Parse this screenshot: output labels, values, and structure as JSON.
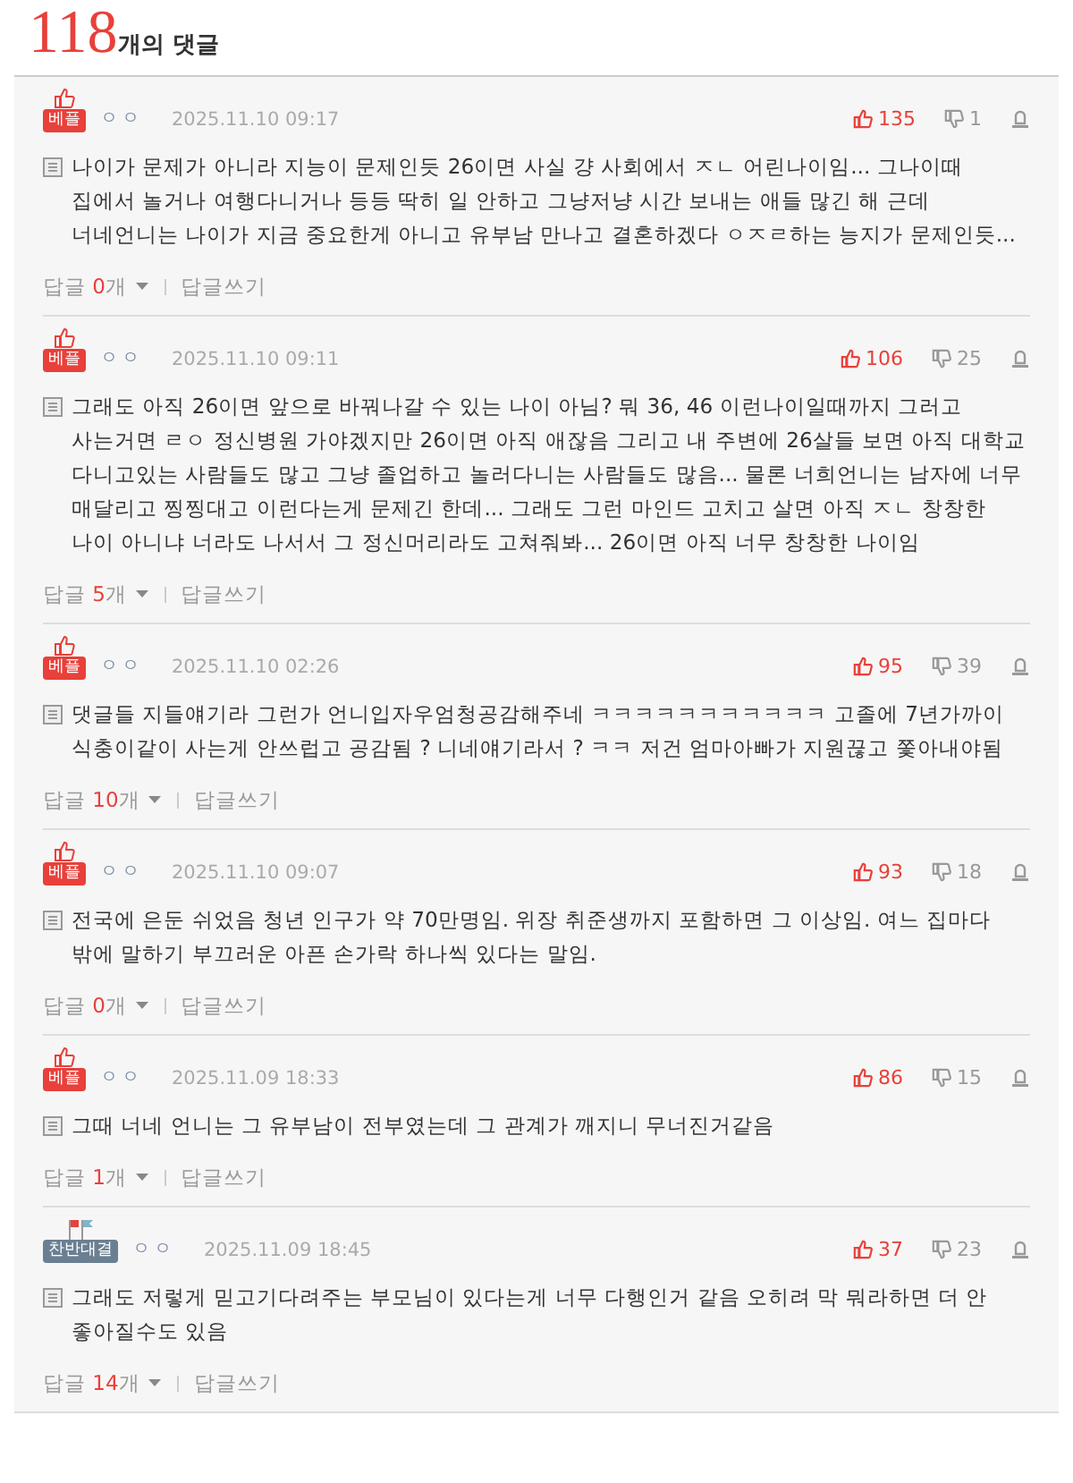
{
  "header": {
    "count": "118",
    "label": "개의 댓글"
  },
  "comments": [
    {
      "badge": {
        "kind": "best",
        "text": "베플"
      },
      "author": "ㅇㅇ",
      "date": "2025.11.10 09:17",
      "likes": "135",
      "dislikes": "1",
      "body": "나이가 문제가 아니라 지능이 문제인듯 26이면 사실 걍 사회에서 ㅈㄴ 어린나이임... 그나이때 집에서 놀거나 여행다니거나 등등 딱히 일 안하고 그냥저냥 시간 보내는 애들 많긴 해 근데 너네언니는 나이가 지금 중요한게 아니고 유부남 만나고 결혼하겠다 ㅇㅈㄹ하는 능지가 문제인듯...",
      "replies_label": "답글",
      "reply_count": "0",
      "reply_unit": "개",
      "write_label": "답글쓰기"
    },
    {
      "badge": {
        "kind": "best",
        "text": "베플"
      },
      "author": "ㅇㅇ",
      "date": "2025.11.10 09:11",
      "likes": "106",
      "dislikes": "25",
      "body": "그래도 아직 26이면 앞으로 바꿔나갈 수 있는 나이 아님? 뭐 36, 46 이런나이일때까지 그러고 사는거면 ㄹㅇ 정신병원 가야겠지만 26이면 아직 애잖음 그리고 내 주변에 26살들 보면 아직 대학교 다니고있는 사람들도 많고 그냥 졸업하고 놀러다니는 사람들도 많음... 물론 너희언니는 남자에 너무 매달리고 찡찡대고 이런다는게 문제긴 한데... 그래도 그런 마인드 고치고 살면 아직 ㅈㄴ 창창한 나이 아니냐 너라도 나서서 그 정신머리라도 고쳐줘봐... 26이면 아직 너무 창창한 나이임",
      "replies_label": "답글",
      "reply_count": "5",
      "reply_unit": "개",
      "write_label": "답글쓰기"
    },
    {
      "badge": {
        "kind": "best",
        "text": "베플"
      },
      "author": "ㅇㅇ",
      "date": "2025.11.10 02:26",
      "likes": "95",
      "dislikes": "39",
      "body": "댓글들 지들얘기라 그런가 언니입자우엄청공감해주네 ㅋㅋㅋㅋㅋㅋㅋㅋㅋㅋㅋ 고졸에 7년가까이 식충이같이 사는게 안쓰럽고 공감됨 ? 니네얘기라서 ? ㅋㅋ 저건 엄마아빠가 지원끊고 쫓아내야됨",
      "replies_label": "답글",
      "reply_count": "10",
      "reply_unit": "개",
      "write_label": "답글쓰기"
    },
    {
      "badge": {
        "kind": "best",
        "text": "베플"
      },
      "author": "ㅇㅇ",
      "date": "2025.11.10 09:07",
      "likes": "93",
      "dislikes": "18",
      "body": "전국에 은둔 쉬었음 청년 인구가 약 70만명임. 위장 취준생까지 포함하면 그 이상임. 여느 집마다 밖에 말하기 부끄러운 아픈 손가락 하나씩 있다는 말임.",
      "replies_label": "답글",
      "reply_count": "0",
      "reply_unit": "개",
      "write_label": "답글쓰기"
    },
    {
      "badge": {
        "kind": "best",
        "text": "베플"
      },
      "author": "ㅇㅇ",
      "date": "2025.11.09 18:33",
      "likes": "86",
      "dislikes": "15",
      "body": "그때 너네 언니는 그 유부남이 전부였는데 그 관계가 깨지니 무너진거같음",
      "replies_label": "답글",
      "reply_count": "1",
      "reply_unit": "개",
      "write_label": "답글쓰기"
    },
    {
      "badge": {
        "kind": "versus",
        "text": "찬반대결"
      },
      "author": "ㅇㅇ",
      "date": "2025.11.09 18:45",
      "likes": "37",
      "dislikes": "23",
      "body": "그래도 저렇게 믿고기다려주는 부모님이 있다는게 너무 다행인거 같음 오히려 막 뭐라하면 더 안 좋아질수도 있음",
      "replies_label": "답글",
      "reply_count": "14",
      "reply_unit": "개",
      "write_label": "답글쓰기"
    }
  ]
}
